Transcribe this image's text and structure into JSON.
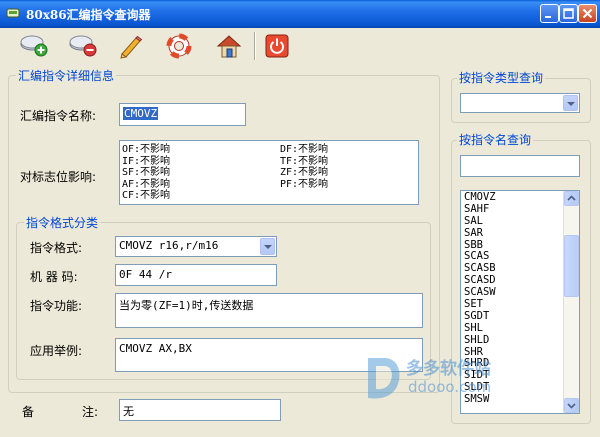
{
  "window": {
    "title": "80x86汇编指令查询器"
  },
  "toolbar": {
    "buttons": [
      {
        "icon": "add-disk-icon"
      },
      {
        "icon": "remove-disk-icon"
      },
      {
        "icon": "pencil-icon"
      },
      {
        "icon": "lifebuoy-icon"
      },
      {
        "icon": "home-icon"
      },
      {
        "icon": "power-icon"
      }
    ]
  },
  "detail": {
    "legend": "汇编指令详细信息",
    "name_label": "汇编指令名称:",
    "name_value": "CMOVZ",
    "flags_label": "对标志位影响:",
    "flags": [
      {
        "text": "OF:不影响"
      },
      {
        "text": "DF:不影响"
      },
      {
        "text": "IF:不影响"
      },
      {
        "text": "TF:不影响"
      },
      {
        "text": "SF:不影响"
      },
      {
        "text": "ZF:不影响"
      },
      {
        "text": "AF:不影响"
      },
      {
        "text": "PF:不影响"
      },
      {
        "text": "CF:不影响"
      }
    ]
  },
  "format": {
    "legend": "指令格式分类",
    "format_label": "指令格式:",
    "format_value": "CMOVZ r16,r/m16",
    "code_label": "机 器 码:",
    "code_value": "0F 44 /r",
    "function_label": "指令功能:",
    "function_value": "当为零(ZF=1)时,传送数据",
    "example_label": "应用举例:",
    "example_value": "CMOVZ AX,BX"
  },
  "remark": {
    "label_left": "备",
    "label_right": "注:",
    "value": "无"
  },
  "type_query": {
    "legend": "按指令类型查询",
    "selected": ""
  },
  "name_query": {
    "legend": "按指令名查询",
    "search_value": "",
    "items": [
      "CMOVZ",
      "SAHF",
      "SAL",
      "SAR",
      "SBB",
      "SCAS",
      "SCASB",
      "SCASD",
      "SCASW",
      "SET",
      "SGDT",
      "SHL",
      "SHLD",
      "SHR",
      "SHRD",
      "SIDT",
      "SLDT",
      "SMSW"
    ]
  },
  "watermark": {
    "text": "多多软件站",
    "url_text": "ddooo.com"
  }
}
